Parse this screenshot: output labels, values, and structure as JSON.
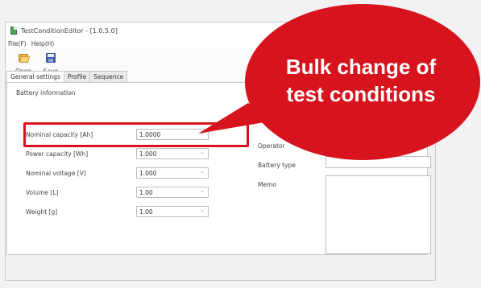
{
  "window": {
    "title": "TestConditionEditor - [1.0.5.0]"
  },
  "menu": {
    "items": [
      {
        "label": "File(F)"
      },
      {
        "label": "Help(H)"
      }
    ]
  },
  "toolbar": {
    "open_label": "Open",
    "save_label": "Save"
  },
  "tabs": [
    {
      "label": "General settings",
      "active": true
    },
    {
      "label": "Profile",
      "active": false
    },
    {
      "label": "Sequence",
      "active": false
    }
  ],
  "battery_info": {
    "group_label": "Battery information",
    "fields": [
      {
        "label": "Nominal capacity [Ah]",
        "value": "1.0000"
      },
      {
        "label": "Power capacity [Wh]",
        "value": "1.000"
      },
      {
        "label": "Nominal voltage [V]",
        "value": "1.000"
      },
      {
        "label": "Volume [L]",
        "value": "1.00"
      },
      {
        "label": "Weight [g]",
        "value": "1.00"
      }
    ]
  },
  "right_fields": {
    "operator_label": "Operator",
    "battery_type_label": "Battery type",
    "memo_label": "Memo"
  },
  "callout": {
    "line1": "Bulk change of",
    "line2": "test conditions",
    "color": "#d7141e"
  }
}
